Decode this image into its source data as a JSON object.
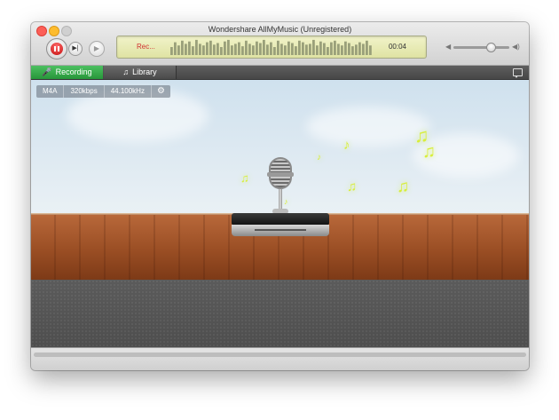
{
  "window": {
    "title": "Wondershare AllMyMusic (Unregistered)"
  },
  "toolbar": {
    "lcd_status": "Rec...",
    "lcd_time": "00:04",
    "volume_level": 0.68,
    "wave_levels": [
      0.5,
      0.8,
      0.6,
      0.9,
      0.7,
      0.85,
      0.55,
      0.95,
      0.7,
      0.6,
      0.8,
      0.9,
      0.65,
      0.75,
      0.5,
      0.85,
      0.95,
      0.6,
      0.7,
      0.8,
      0.55,
      0.9,
      0.7,
      0.6,
      0.85,
      0.75,
      0.95,
      0.65,
      0.8,
      0.5,
      0.9,
      0.7,
      0.6,
      0.85,
      0.75,
      0.55,
      0.9,
      0.8,
      0.65,
      0.7,
      0.95,
      0.6,
      0.85,
      0.75,
      0.5,
      0.8,
      0.9,
      0.7,
      0.6,
      0.85,
      0.75,
      0.55,
      0.65,
      0.8,
      0.7,
      0.9,
      0.6
    ]
  },
  "tabs": [
    {
      "label": "Recording",
      "icon": "microphone-icon",
      "active": true
    },
    {
      "label": "Library",
      "icon": "music-note-icon",
      "active": false
    }
  ],
  "info": {
    "format": "M4A",
    "bitrate": "320kbps",
    "sample_rate": "44.100kHz"
  },
  "colors": {
    "accent_green": "#2ea043",
    "lcd": "#e9ecb6",
    "status_red": "#d03030",
    "note_glow": "#d8ee3a"
  }
}
